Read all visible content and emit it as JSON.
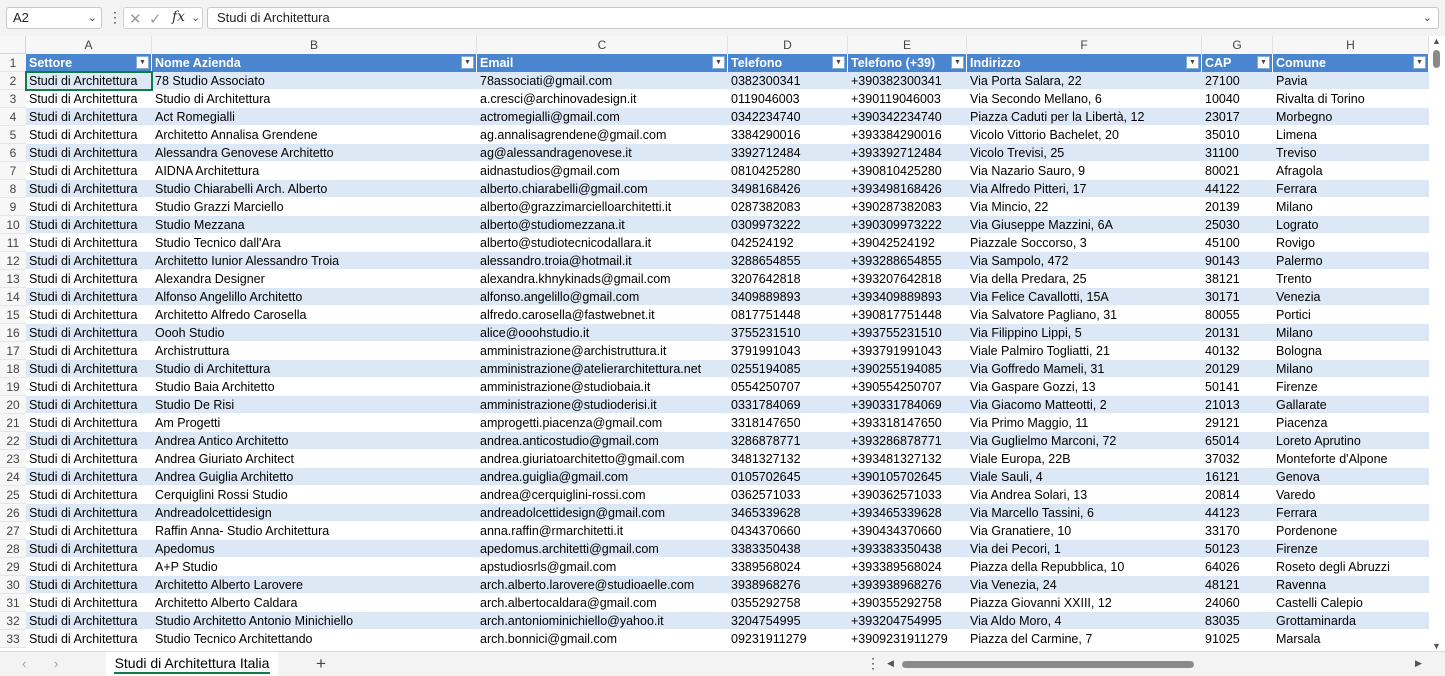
{
  "formula_bar": {
    "name_box": "A2",
    "fx": "fx",
    "value": "Studi di Architettura"
  },
  "columns": [
    "A",
    "B",
    "C",
    "D",
    "E",
    "F",
    "G",
    "H"
  ],
  "headers": [
    "Settore",
    "Nome Azienda",
    "Email",
    "Telefono",
    "Telefono (+39)",
    "Indirizzo",
    "CAP",
    "Comune"
  ],
  "rows": [
    [
      "Studi di Architettura",
      "78 Studio Associato",
      "78associati@gmail.com",
      "0382300341",
      "+390382300341",
      "Via Porta Salara, 22",
      "27100",
      "Pavia"
    ],
    [
      "Studi di Architettura",
      "Studio di Architettura",
      "a.cresci@archinovadesign.it",
      "0119046003",
      "+390119046003",
      "Via Secondo Mellano, 6",
      "10040",
      "Rivalta di Torino"
    ],
    [
      "Studi di Architettura",
      "Act Romegialli",
      "actromegialli@gmail.com",
      "0342234740",
      "+390342234740",
      "Piazza Caduti per la Libertà, 12",
      "23017",
      "Morbegno"
    ],
    [
      "Studi di Architettura",
      "Architetto Annalisa Grendene",
      "ag.annalisagrendene@gmail.com",
      "3384290016",
      "+393384290016",
      "Vicolo Vittorio Bachelet, 20",
      "35010",
      "Limena"
    ],
    [
      "Studi di Architettura",
      "Alessandra Genovese Architetto",
      "ag@alessandragenovese.it",
      "3392712484",
      "+393392712484",
      "Vicolo Trevisi, 25",
      "31100",
      "Treviso"
    ],
    [
      "Studi di Architettura",
      "AIDNA Architettura",
      "aidnastudios@gmail.com",
      "0810425280",
      "+390810425280",
      "Via Nazario Sauro, 9",
      "80021",
      "Afragola"
    ],
    [
      "Studi di Architettura",
      "Studio Chiarabelli Arch. Alberto",
      "alberto.chiarabelli@gmail.com",
      "3498168426",
      "+393498168426",
      "Via Alfredo Pitteri, 17",
      "44122",
      "Ferrara"
    ],
    [
      "Studi di Architettura",
      "Studio Grazzi Marciello",
      "alberto@grazzimarcielloarchitetti.it",
      "0287382083",
      "+390287382083",
      "Via Mincio, 22",
      "20139",
      "Milano"
    ],
    [
      "Studi di Architettura",
      "Studio Mezzana",
      "alberto@studiomezzana.it",
      "0309973222",
      "+390309973222",
      "Via Giuseppe Mazzini, 6A",
      "25030",
      "Lograto"
    ],
    [
      "Studi di Architettura",
      "Studio Tecnico dall'Ara",
      "alberto@studiotecnicodallara.it",
      "042524192",
      "+39042524192",
      "Piazzale Soccorso, 3",
      "45100",
      "Rovigo"
    ],
    [
      "Studi di Architettura",
      "Architetto Iunior Alessandro Troia",
      "alessandro.troia@hotmail.it",
      "3288654855",
      "+393288654855",
      "Via Sampolo, 472",
      "90143",
      "Palermo"
    ],
    [
      "Studi di Architettura",
      "Alexandra Designer",
      "alexandra.khnykinads@gmail.com",
      "3207642818",
      "+393207642818",
      "Via della Predara, 25",
      "38121",
      "Trento"
    ],
    [
      "Studi di Architettura",
      "Alfonso Angelillo Architetto",
      "alfonso.angelillo@gmail.com",
      "3409889893",
      "+393409889893",
      "Via Felice Cavallotti, 15A",
      "30171",
      "Venezia"
    ],
    [
      "Studi di Architettura",
      "Architetto Alfredo Carosella",
      "alfredo.carosella@fastwebnet.it",
      "0817751448",
      "+390817751448",
      "Via Salvatore Pagliano, 31",
      "80055",
      "Portici"
    ],
    [
      "Studi di Architettura",
      "Oooh Studio",
      "alice@ooohstudio.it",
      "3755231510",
      "+393755231510",
      "Via Filippino Lippi, 5",
      "20131",
      "Milano"
    ],
    [
      "Studi di Architettura",
      "Archistruttura",
      "amministrazione@archistruttura.it",
      "3791991043",
      "+393791991043",
      "Viale Palmiro Togliatti, 21",
      "40132",
      "Bologna"
    ],
    [
      "Studi di Architettura",
      "Studio di Architettura",
      "amministrazione@atelierarchitettura.net",
      "0255194085",
      "+390255194085",
      "Via Goffredo Mameli, 31",
      "20129",
      "Milano"
    ],
    [
      "Studi di Architettura",
      "Studio Baia Architetto",
      "amministrazione@studiobaia.it",
      "0554250707",
      "+390554250707",
      "Via Gaspare Gozzi, 13",
      "50141",
      "Firenze"
    ],
    [
      "Studi di Architettura",
      "Studio De Risi",
      "amministrazione@studioderisi.it",
      "0331784069",
      "+390331784069",
      "Via Giacomo Matteotti, 2",
      "21013",
      "Gallarate"
    ],
    [
      "Studi di Architettura",
      "Am Progetti",
      "amprogetti.piacenza@gmail.com",
      "3318147650",
      "+393318147650",
      "Via Primo Maggio, 11",
      "29121",
      "Piacenza"
    ],
    [
      "Studi di Architettura",
      "Andrea Antico Architetto",
      "andrea.anticostudio@gmail.com",
      "3286878771",
      "+393286878771",
      "Via Guglielmo Marconi, 72",
      "65014",
      "Loreto Aprutino"
    ],
    [
      "Studi di Architettura",
      "Andrea Giuriato Architect",
      "andrea.giuriatoarchitetto@gmail.com",
      "3481327132",
      "+393481327132",
      "Viale Europa, 22B",
      "37032",
      "Monteforte d'Alpone"
    ],
    [
      "Studi di Architettura",
      "Andrea Guiglia Architetto",
      "andrea.guiglia@gmail.com",
      "0105702645",
      "+390105702645",
      "Viale Sauli, 4",
      "16121",
      "Genova"
    ],
    [
      "Studi di Architettura",
      "Cerquiglini Rossi Studio",
      "andrea@cerquiglini-rossi.com",
      "0362571033",
      "+390362571033",
      "Via Andrea Solari, 13",
      "20814",
      "Varedo"
    ],
    [
      "Studi di Architettura",
      "Andreadolcettidesign",
      "andreadolcettidesign@gmail.com",
      "3465339628",
      "+393465339628",
      "Via Marcello Tassini, 6",
      "44123",
      "Ferrara"
    ],
    [
      "Studi di Architettura",
      "Raffin Anna- Studio Architettura",
      "anna.raffin@rmarchitetti.it",
      "0434370660",
      "+390434370660",
      "Via Granatiere, 10",
      "33170",
      "Pordenone"
    ],
    [
      "Studi di Architettura",
      "Apedomus",
      "apedomus.architetti@gmail.com",
      "3383350438",
      "+393383350438",
      "Via dei Pecori, 1",
      "50123",
      "Firenze"
    ],
    [
      "Studi di Architettura",
      "A+P Studio",
      "apstudiosrls@gmail.com",
      "3389568024",
      "+393389568024",
      "Piazza della Repubblica, 10",
      "64026",
      "Roseto degli Abruzzi"
    ],
    [
      "Studi di Architettura",
      "Architetto Alberto Larovere",
      "arch.alberto.larovere@studioaelle.com",
      "3938968276",
      "+393938968276",
      "Via Venezia, 24",
      "48121",
      "Ravenna"
    ],
    [
      "Studi di Architettura",
      "Architetto Alberto Caldara",
      "arch.albertocaldara@gmail.com",
      "0355292758",
      "+390355292758",
      "Piazza Giovanni XXIII, 12",
      "24060",
      "Castelli Calepio"
    ],
    [
      "Studi di Architettura",
      "Studio Architetto Antonio Minichiello",
      "arch.antoniominichiello@yahoo.it",
      "3204754995",
      "+393204754995",
      "Via Aldo Moro, 4",
      "83035",
      "Grottaminarda"
    ],
    [
      "Studi di Architettura",
      "Studio Tecnico Architettando",
      "arch.bonnici@gmail.com",
      "09231911279",
      "+3909231911279",
      "Piazza del Carmine, 7",
      "91025",
      "Marsala"
    ]
  ],
  "sheet_tab": "Studi di Architettura Italia",
  "add_sheet": "+",
  "colors": {
    "header_fill": "#4a86cf",
    "band_fill": "#dde8f6",
    "selection": "#107c41"
  }
}
